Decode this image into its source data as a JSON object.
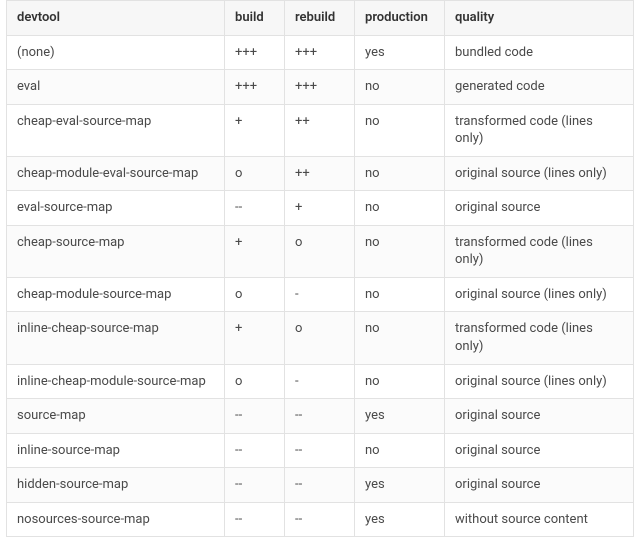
{
  "chart_data": {
    "type": "table",
    "title": "",
    "columns": [
      "devtool",
      "build",
      "rebuild",
      "production",
      "quality"
    ],
    "rows": [
      [
        "(none)",
        "+++",
        "+++",
        "yes",
        "bundled code"
      ],
      [
        "eval",
        "+++",
        "+++",
        "no",
        "generated code"
      ],
      [
        "cheap-eval-source-map",
        "+",
        "++",
        "no",
        "transformed code (lines only)"
      ],
      [
        "cheap-module-eval-source-map",
        "o",
        "++",
        "no",
        "original source (lines only)"
      ],
      [
        "eval-source-map",
        "--",
        "+",
        "no",
        "original source"
      ],
      [
        "cheap-source-map",
        "+",
        "o",
        "no",
        "transformed code (lines only)"
      ],
      [
        "cheap-module-source-map",
        "o",
        "-",
        "no",
        "original source (lines only)"
      ],
      [
        "inline-cheap-source-map",
        "+",
        "o",
        "no",
        "transformed code (lines only)"
      ],
      [
        "inline-cheap-module-source-map",
        "o",
        "-",
        "no",
        "original source (lines only)"
      ],
      [
        "source-map",
        "--",
        "--",
        "yes",
        "original source"
      ],
      [
        "inline-source-map",
        "--",
        "--",
        "no",
        "original source"
      ],
      [
        "hidden-source-map",
        "--",
        "--",
        "yes",
        "original source"
      ],
      [
        "nosources-source-map",
        "--",
        "--",
        "yes",
        "without source content"
      ]
    ]
  }
}
